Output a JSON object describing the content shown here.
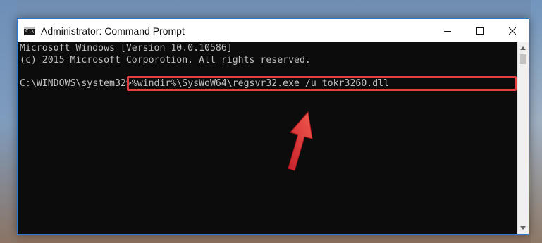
{
  "window": {
    "title": "Administrator: Command Prompt",
    "icon_name": "cmd-icon",
    "icon_text": "C:\\",
    "controls": [
      "minimize-icon",
      "maximize-icon",
      "close-icon"
    ]
  },
  "console": {
    "line1": "Microsoft Windows [Version 10.0.10586]",
    "line2": "(c) 2015 Microsoft Corporotion. All rights reserved.",
    "prompt": "C:\\WINDOWS\\system32>",
    "command": "%windir%\\SysWoW64\\regsvr32.exe /u tokr3260.dll"
  },
  "annotation": {
    "highlight_color": "#e0403f",
    "arrow_icon": "red-arrow-icon"
  },
  "colors": {
    "console_bg": "#0c0c0c",
    "console_text": "#c0c0c0",
    "window_border": "#2b79d0"
  }
}
